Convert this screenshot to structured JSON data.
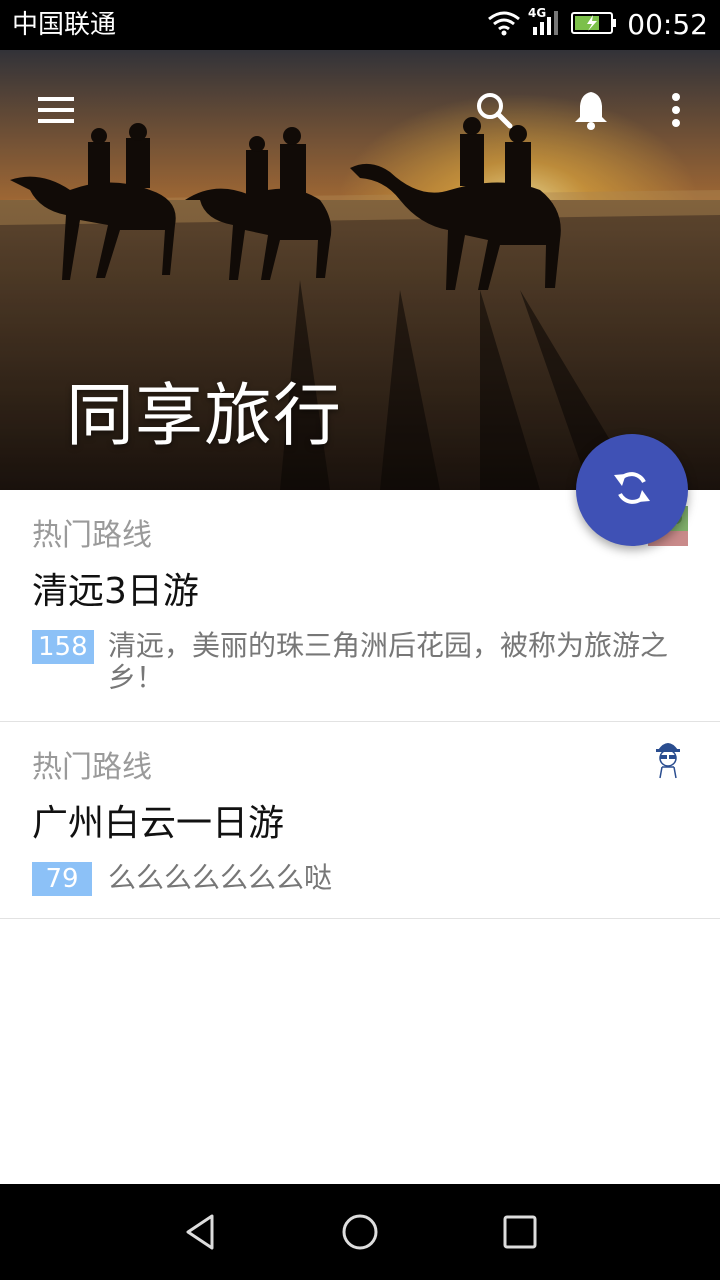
{
  "status_bar": {
    "carrier": "中国联通",
    "network": "4G",
    "time": "00:52"
  },
  "header": {
    "title": "同享旅行",
    "icons": [
      "menu-icon",
      "search-icon",
      "bell-icon",
      "more-vert-icon"
    ]
  },
  "fab": {
    "icon": "refresh-icon",
    "color": "#3f51b5"
  },
  "cards": [
    {
      "category": "热门路线",
      "title": "清远3日游",
      "count": "158",
      "description": "清远，美丽的珠三角洲后花园，被称为旅游之乡！"
    },
    {
      "category": "热门路线",
      "title": "广州白云一日游",
      "count": "79",
      "description": "么么么么么么么哒"
    }
  ],
  "colors": {
    "accent": "#3f51b5",
    "badge": "#8cc1f7",
    "category_text": "#9a9a9a"
  },
  "navbar": {
    "icons": [
      "back-icon",
      "home-icon",
      "recents-icon"
    ]
  }
}
